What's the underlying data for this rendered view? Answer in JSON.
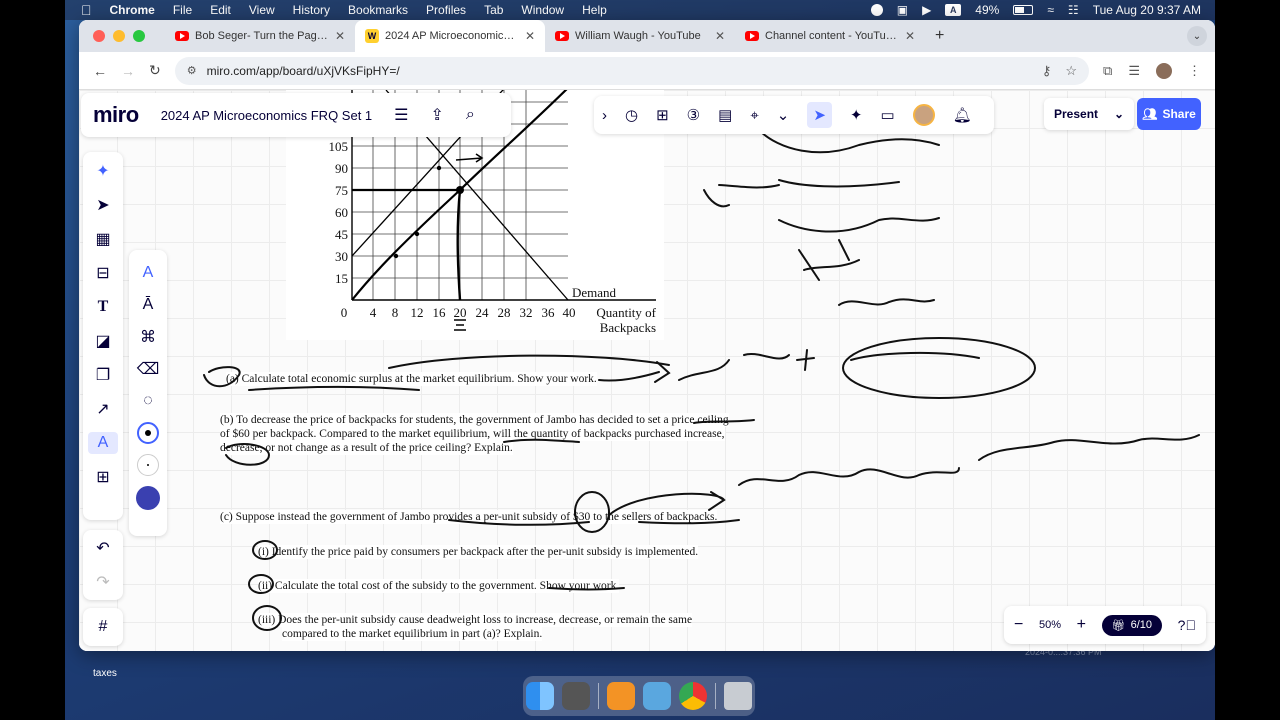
{
  "menubar": {
    "app": "Chrome",
    "items": [
      "File",
      "Edit",
      "View",
      "History",
      "Bookmarks",
      "Profiles",
      "Tab",
      "Window",
      "Help"
    ],
    "battery": "49%",
    "clock": "Tue Aug 20  9:37 AM",
    "input_badge": "A"
  },
  "browser": {
    "tabs": [
      {
        "title": "Bob Seger- Turn the Page - Y",
        "favicon": "youtube-icon"
      },
      {
        "title": "2024 AP Microeconomics FR",
        "favicon": "miro-icon"
      },
      {
        "title": "William Waugh - YouTube",
        "favicon": "youtube-icon"
      },
      {
        "title": "Channel content - YouTube S",
        "favicon": "youtube-icon"
      }
    ],
    "url": "miro.com/app/board/uXjVKsFipHY=/"
  },
  "miro": {
    "logo": "miro",
    "board_title": "2024 AP Microeconomics FRQ Set 1",
    "present_label": "Present",
    "share_label": "Share",
    "zoom": "50%",
    "pager": "6/10",
    "miro_favicon_letter": "W"
  },
  "graph": {
    "y_ticks": [
      "105",
      "90",
      "75",
      "60",
      "45",
      "30",
      "15",
      "0"
    ],
    "x_ticks": [
      "4",
      "8",
      "12",
      "16",
      "20",
      "24",
      "28",
      "32",
      "36",
      "40"
    ],
    "demand_label": "Demand",
    "x_axis_label_1": "Quantity of",
    "x_axis_label_2": "Backpacks"
  },
  "questions": {
    "a": "(a) Calculate total economic surplus at the market equilibrium. Show your work.",
    "b1": "(b) To decrease the price of backpacks for students, the government of Jambo has decided to set a price ceiling",
    "b2": "of $60 per backpack. Compared to the market equilibrium, will the quantity of backpacks purchased increase,",
    "b3": "decrease, or not change as a result of the price ceiling? Explain.",
    "c": "(c) Suppose instead the government of Jambo provides a per-unit subsidy of $30 to the sellers of backpacks.",
    "ci": "(i) Identify the price paid by consumers per backpack after the per-unit subsidy is implemented.",
    "cii": "(ii) Calculate the total cost of the subsidy to the government. Show your work.",
    "ciii1": "(iii) Does the per-unit subsidy cause deadweight loss to increase, decrease, or remain the same",
    "ciii2": "compared to the market equilibrium in part (a)? Explain."
  },
  "desktop": {
    "folder_label": "taxes",
    "ghost_label": "2024-0....37.36 PM"
  }
}
